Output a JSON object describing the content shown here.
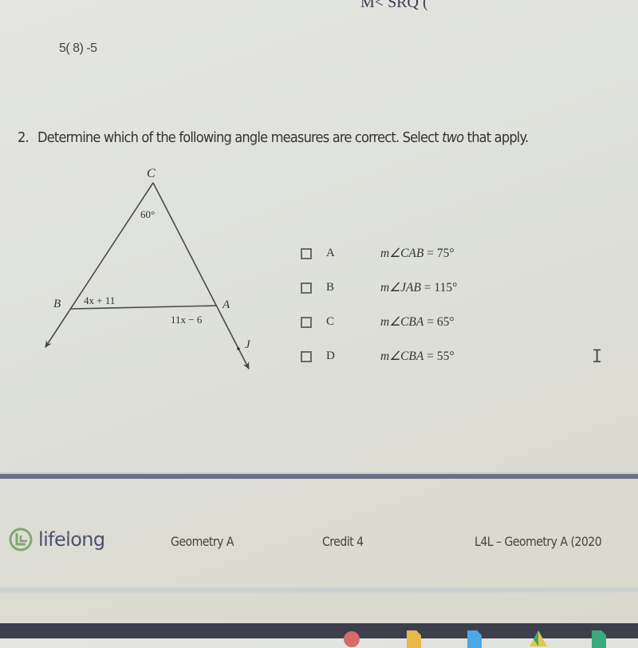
{
  "top_cutoff_text": "M< SRQ (",
  "previous_answer": "5( 8) -5",
  "question": {
    "number": "2.",
    "text_before": "Determine which of the following angle measures are correct. Select ",
    "emphasis": "two",
    "text_after": " that apply."
  },
  "figure": {
    "vertex_labels": {
      "C": "C",
      "B": "B",
      "A": "A",
      "J": "J"
    },
    "angle_labels": {
      "C": "60°",
      "B": "4x + 11",
      "A": "11x − 6"
    }
  },
  "options": [
    {
      "letter": "A",
      "prefix": "m∠",
      "angle": "CAB",
      "value": " = 75°",
      "checked": false
    },
    {
      "letter": "B",
      "prefix": "m∠",
      "angle": "JAB",
      "value": " = 115°",
      "checked": false
    },
    {
      "letter": "C",
      "prefix": "m∠",
      "angle": "CBA",
      "value": " = 65°",
      "checked": false
    },
    {
      "letter": "D",
      "prefix": "m∠",
      "angle": "CBA",
      "value": " = 55°",
      "checked": false
    }
  ],
  "footer": {
    "logo_text": "lifelong",
    "logo_subtext": "LEARNING",
    "course": "Geometry A",
    "credit": "Credit 4",
    "course_code": "L4L – Geometry A (2020"
  },
  "colors": {
    "logo_green": "#7fa870",
    "logo_text": "#4c4f6d",
    "separator": "#6b7089",
    "taskbar": "#3e3f4d"
  },
  "taskbar_icons": [
    "gmail-icon",
    "slides-icon",
    "docs-icon",
    "drive-icon",
    "sheets-icon"
  ]
}
